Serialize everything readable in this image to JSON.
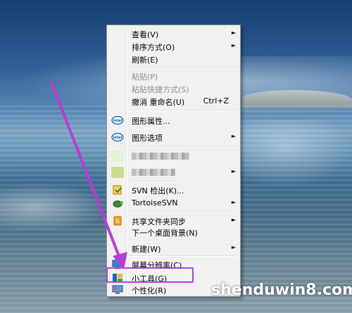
{
  "menu": {
    "items": [
      {
        "label": "查看(V)",
        "has_submenu": true,
        "icon": ""
      },
      {
        "label": "排序方式(O)",
        "has_submenu": true,
        "icon": ""
      },
      {
        "label": "刷新(E)",
        "has_submenu": false,
        "icon": ""
      },
      {
        "label": "粘贴(P)",
        "disabled": true
      },
      {
        "label": "粘贴快捷方式(S)",
        "disabled": true
      },
      {
        "label": "撤消 重命名(U)",
        "shortcut": "Ctrl+Z"
      },
      {
        "label": "图形属性...",
        "icon": "intel-icon"
      },
      {
        "label": "图形选项",
        "icon": "intel-icon",
        "has_submenu": true
      },
      {
        "label": "",
        "icon": "blurred-icon",
        "blurred": true
      },
      {
        "label": "",
        "icon": "blurred-icon",
        "blurred": true,
        "has_submenu": true
      },
      {
        "label": "SVN 检出(K)...",
        "icon": "svn-checkout-icon"
      },
      {
        "label": "TortoiseSVN",
        "icon": "tortoisesvn-icon",
        "has_submenu": true
      },
      {
        "label": "共享文件夹同步",
        "icon": "sync-icon",
        "has_submenu": true
      },
      {
        "label": "下一个桌面背景(N)"
      },
      {
        "label": "新建(W)",
        "has_submenu": true
      },
      {
        "label": "屏幕分辨率(C)",
        "icon": "screen-resolution-icon"
      },
      {
        "label": "小工具(G)",
        "icon": "gadgets-icon"
      },
      {
        "label": "个性化(R)",
        "icon": "personalize-icon"
      }
    ],
    "submenu_arrow": "►"
  },
  "annotation": {
    "arrow_color": "#b53fd2",
    "highlight_color": "#b53fd2"
  },
  "watermark": "shenduwin8.com"
}
